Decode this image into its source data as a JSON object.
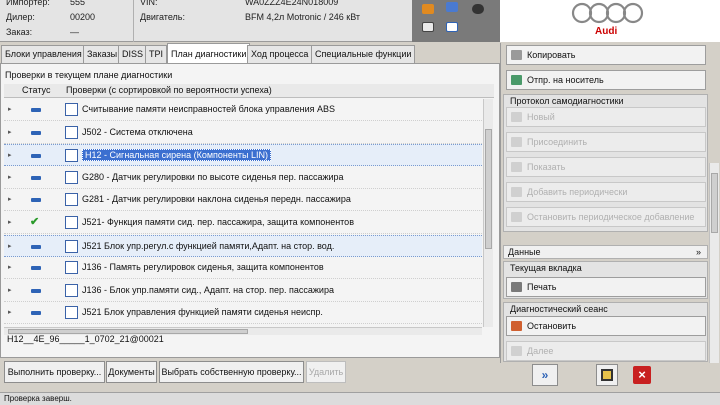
{
  "header": {
    "importer_label": "Импортер:",
    "importer_value": "555",
    "dealer_label": "Дилер:",
    "dealer_value": "00200",
    "order_label": "Заказ:",
    "order_value": "—",
    "vin_label": "VIN:",
    "vin_value": "WA0ZZZ4E24N018009",
    "engine_label": "Двигатель:",
    "engine_value": "BFM 4,2л Motronic / 246 кВт",
    "brand": "Audi"
  },
  "tabs": [
    "Блоки управления",
    "Заказы",
    "DISS",
    "TPI",
    "План диагностики",
    "Ход процесса",
    "Специальные функции"
  ],
  "plan": {
    "title": "Проверки в текущем плане диагностики",
    "col_status": "Статус",
    "col_checks": "Проверки (с сортировкой по вероятности успеха)",
    "rows": [
      {
        "text": "Считывание памяти неисправностей блока управления ABS",
        "status": "dash"
      },
      {
        "text": "J502 - Система отключена",
        "status": "dash"
      },
      {
        "text": "H12 - Сигнальная сирена (Компоненты LIN)",
        "status": "dash",
        "selected": true
      },
      {
        "text": "G280 - Датчик регулировки по высоте сиденья пер. пассажира",
        "status": "dash"
      },
      {
        "text": "G281 - Датчик регулировки наклона сиденья передн. пассажира",
        "status": "dash"
      },
      {
        "text": "J521- Функция памяти сид. пер. пассажира, защита компонентов",
        "status": "check"
      },
      {
        "text": "J521 Блок упр.регул.с функцией памяти,Адапт. на стор. вод.",
        "status": "dash",
        "selected2": true
      },
      {
        "text": "J136 - Память регулировок сиденья, защита компонентов",
        "status": "dash"
      },
      {
        "text": "J136 - Блок упр.памяти сид., Адапт. на стор. пер. пассажира",
        "status": "dash"
      },
      {
        "text": "J521 Блок управления функцией памяти сиденья неиспр.",
        "status": "dash"
      }
    ],
    "id_line": "H12__4E_96_____1_0702_21@00021"
  },
  "bottom_buttons": {
    "run": "Выполнить проверку...",
    "docs": "Документы",
    "own": "Выбрать собственную проверку...",
    "delete": "Удалить"
  },
  "right": {
    "copy": "Копировать",
    "send": "Отпр. на носитель",
    "selfdiag_label": "Протокол самодиагностики",
    "new": "Новый",
    "attach": "Присоединить",
    "show": "Показать",
    "add_periodic": "Добавить периодически",
    "stop_periodic": "Остановить периодическое добавление",
    "data_label": "Данные",
    "collapse": "»",
    "current_tab_label": "Текущая вкладка",
    "print": "Печать",
    "diag_session_label": "Диагностический сеанс",
    "stop": "Остановить",
    "next": "Далее"
  },
  "status_text": "Проверка заверш."
}
